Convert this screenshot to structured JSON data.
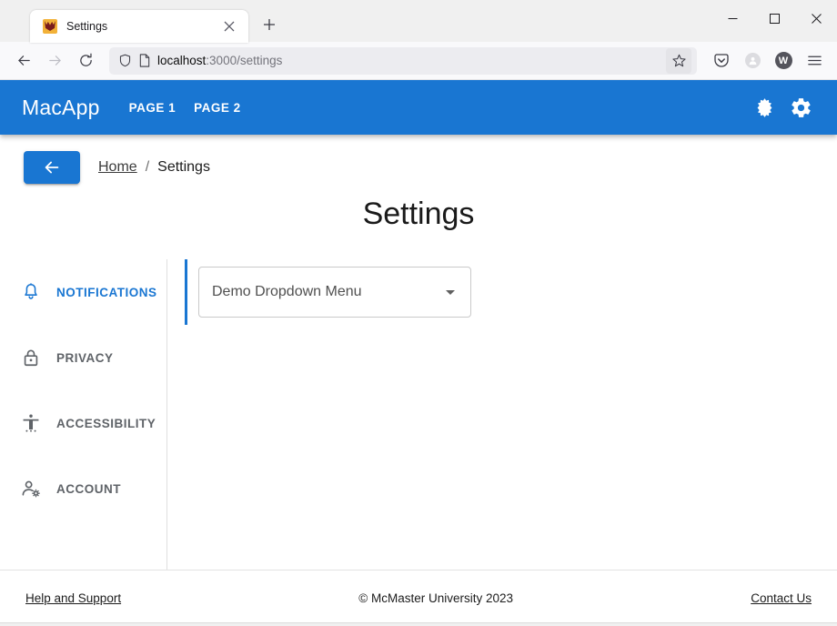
{
  "browser": {
    "tab": {
      "title": "Settings",
      "favicon_icon": "mcmaster-crest-favicon",
      "close_icon": "close-icon"
    },
    "new_tab_icon": "plus-icon",
    "window_controls": {
      "minimize_icon": "minimize-icon",
      "maximize_icon": "maximize-icon",
      "close_icon": "window-close-icon"
    },
    "nav": {
      "back_icon": "arrow-left-icon",
      "forward_icon": "arrow-right-icon",
      "reload_icon": "reload-icon"
    },
    "url": {
      "shield_icon": "shield-icon",
      "page_icon": "page-document-icon",
      "host": "localhost",
      "path": ":3000/settings",
      "bookmark_icon": "star-icon"
    },
    "toolbar": {
      "pocket_icon": "pocket-icon",
      "account_icon": "account-circle-icon",
      "extension_icon": "extension-circle-icon",
      "extension_letter": "W",
      "menu_icon": "hamburger-menu-icon"
    }
  },
  "appbar": {
    "brand": "MacApp",
    "links": [
      {
        "label": "PAGE 1",
        "name": "nav-page-1"
      },
      {
        "label": "PAGE 2",
        "name": "nav-page-2"
      }
    ],
    "dark_mode_icon": "dark-mode-toggle-icon",
    "settings_icon": "gear-icon"
  },
  "breadcrumb": {
    "back_icon": "arrow-left-icon",
    "home": "Home",
    "separator": "/",
    "current": "Settings"
  },
  "page": {
    "title": "Settings"
  },
  "tabs": [
    {
      "label": "NOTIFICATIONS",
      "icon": "bell-icon",
      "active": true
    },
    {
      "label": "PRIVACY",
      "icon": "lock-icon",
      "active": false
    },
    {
      "label": "ACCESSIBILITY",
      "icon": "accessibility-icon",
      "active": false
    },
    {
      "label": "ACCOUNT",
      "icon": "account-gear-icon",
      "active": false
    }
  ],
  "panel": {
    "dropdown": {
      "label": "Demo Dropdown Menu",
      "arrow_icon": "chevron-down-icon"
    }
  },
  "footer": {
    "help_link": "Help and Support",
    "copyright": "© McMaster University 2023",
    "contact_link": "Contact Us"
  },
  "colors": {
    "primary": "#1976d2",
    "tab_inactive": "#5f6368",
    "chrome": "#f0f0f0"
  }
}
